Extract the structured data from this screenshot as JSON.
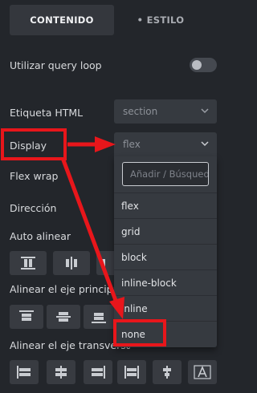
{
  "tabs": {
    "content": "CONTENIDO",
    "style": "• ESTILO"
  },
  "labels": {
    "query_loop": "Utilizar query loop",
    "html_tag": "Etiqueta HTML",
    "display": "Display",
    "flex_wrap": "Flex wrap",
    "direction": "Dirección",
    "auto_align": "Auto alinear",
    "main_axis": "Alinear el eje principal",
    "cross_axis": "Alinear el eje transversal"
  },
  "html_tag_select": {
    "value": "section"
  },
  "display_select": {
    "value": "flex"
  },
  "dropdown": {
    "search_placeholder": "Añadir / Búsqueda",
    "options": [
      "flex",
      "grid",
      "block",
      "inline-block",
      "inline",
      "none"
    ]
  },
  "query_loop_toggle": {
    "on": false
  },
  "colors": {
    "accent_annotation": "#e8161b",
    "background": "#23262b",
    "control": "#363a40"
  },
  "icons": {
    "auto_align": [
      "align-full-icon",
      "align-center-icon",
      "align-end-icon"
    ],
    "main_axis": [
      "justify-start-icon",
      "justify-center-icon",
      "justify-end-icon"
    ],
    "cross_axis": [
      "align-left-icon",
      "align-center-icon",
      "align-right-icon",
      "align-stretch-icon",
      "align-middle-icon",
      "text-baseline-icon"
    ]
  }
}
